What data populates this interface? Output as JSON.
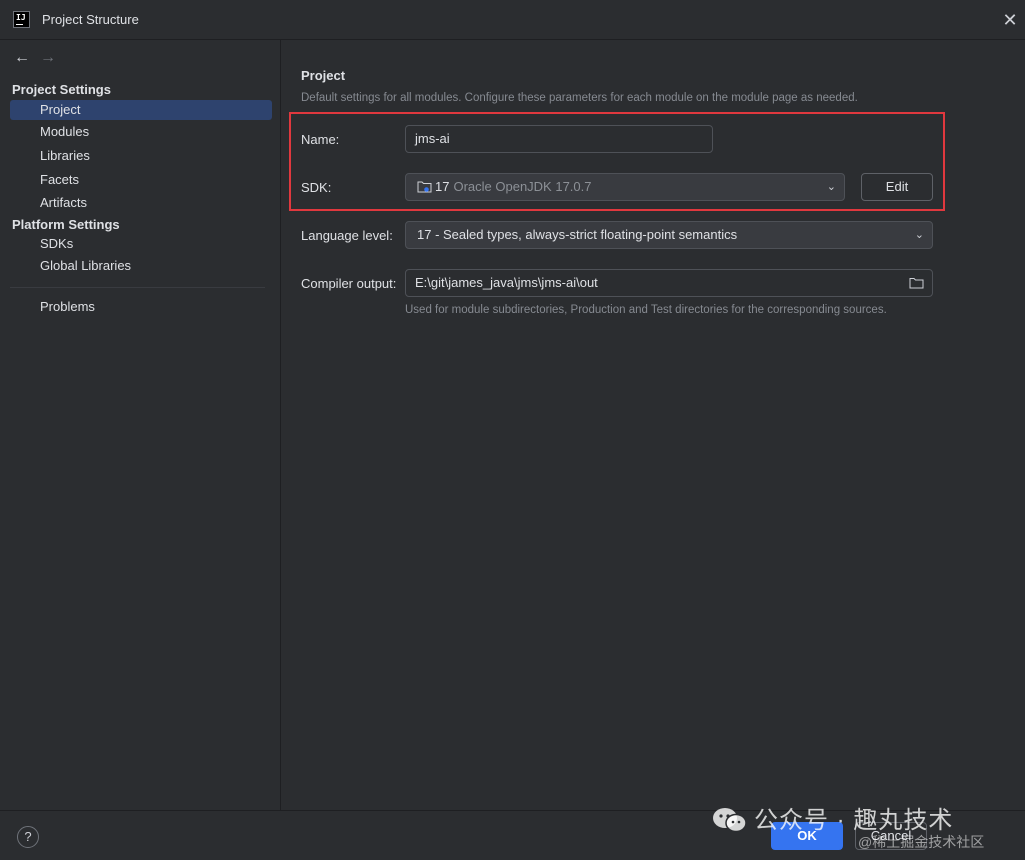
{
  "window": {
    "title": "Project Structure",
    "logo_text": "IJ"
  },
  "nav": {
    "back": "←",
    "forward": "→"
  },
  "sidebar": {
    "project_settings_title": "Project Settings",
    "project_settings_items": [
      "Project",
      "Modules",
      "Libraries",
      "Facets",
      "Artifacts"
    ],
    "platform_settings_title": "Platform Settings",
    "platform_settings_items": [
      "SDKs",
      "Global Libraries"
    ],
    "problems": "Problems",
    "selected": "Project"
  },
  "main": {
    "title": "Project",
    "description": "Default settings for all modules. Configure these parameters for each module on the module page as needed.",
    "name_label": "Name:",
    "name_value": "jms-ai",
    "sdk_label": "SDK:",
    "sdk_version": "17",
    "sdk_name": "Oracle OpenJDK 17.0.7",
    "edit_label": "Edit",
    "language_level_label": "Language level:",
    "language_level_value": "17 - Sealed types, always-strict floating-point semantics",
    "compiler_output_label": "Compiler output:",
    "compiler_output_value": "E:\\git\\james_java\\jms\\jms-ai\\out",
    "compiler_output_hint": "Used for module subdirectories, Production and Test directories for the corresponding sources."
  },
  "footer": {
    "help": "?",
    "ok": "OK",
    "cancel": "Cancel"
  },
  "watermark": {
    "line1": "公众号 · 趣丸技术",
    "line2": "@稀土掘金技术社区"
  },
  "colors": {
    "accent": "#3574f0",
    "selection": "#2e436e",
    "highlight": "#e0383e"
  }
}
